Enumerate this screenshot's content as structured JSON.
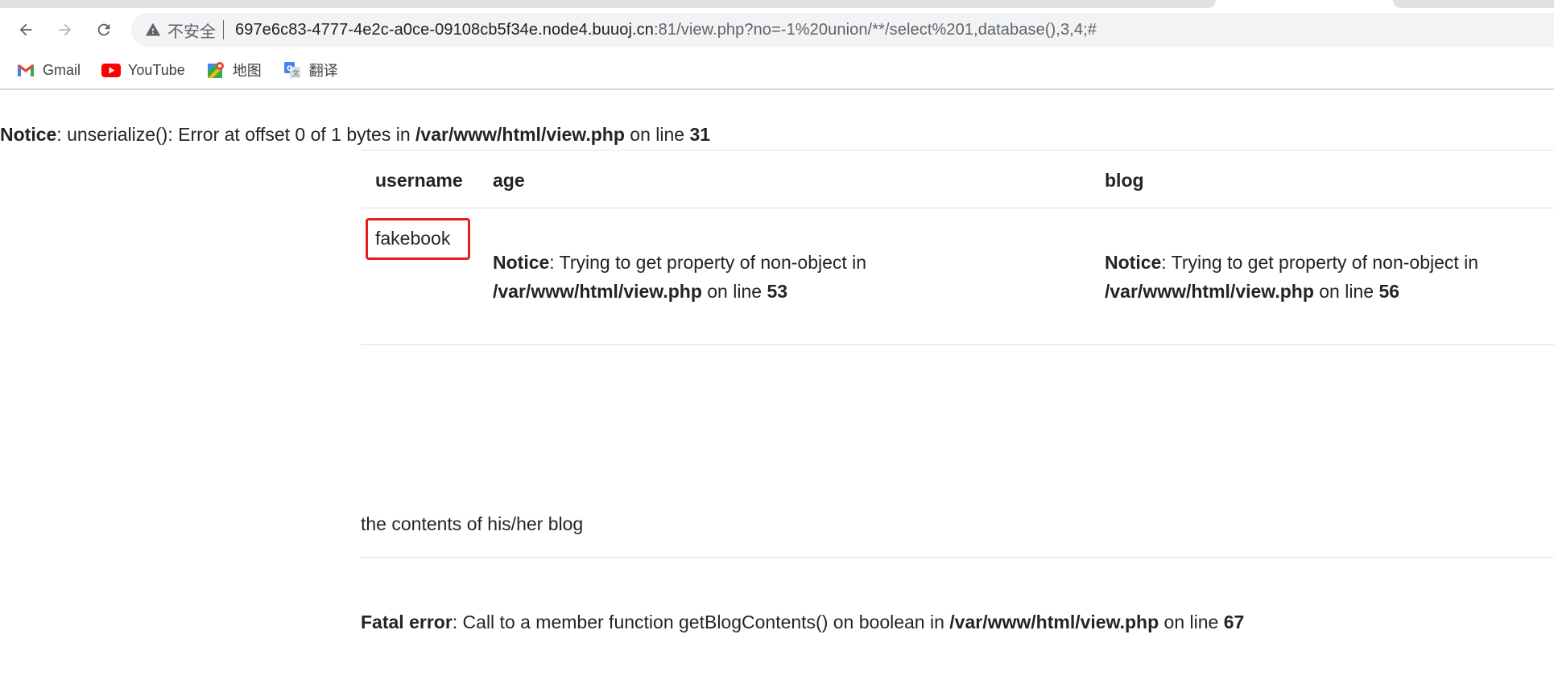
{
  "browser": {
    "address_bar": {
      "security_label": "不安全",
      "url_host": "697e6c83-4777-4e2c-a0ce-09108cb5f34e.node4.buuoj.cn",
      "url_rest": ":81/view.php?no=-1%20union/**/select%201,database(),3,4;#"
    },
    "bookmarks": [
      {
        "label": "Gmail",
        "icon": "gmail-icon"
      },
      {
        "label": "YouTube",
        "icon": "youtube-icon"
      },
      {
        "label": "地图",
        "icon": "maps-icon"
      },
      {
        "label": "翻译",
        "icon": "translate-icon"
      }
    ]
  },
  "page": {
    "notice_top": {
      "label": "Notice",
      "message": ": unserialize(): Error at offset 0 of 1 bytes in ",
      "path": "/var/www/html/view.php",
      "on_line": " on line ",
      "line": "31"
    },
    "table": {
      "headers": [
        "username",
        "age",
        "blog"
      ],
      "row": {
        "username": "fakebook",
        "age_notice": {
          "label": "Notice",
          "message": ": Trying to get property of non-object in",
          "path": "/var/www/html/view.php",
          "on_line": " on line ",
          "line": "53"
        },
        "blog_notice": {
          "label": "Notice",
          "message": ": Trying to get property of non-object in",
          "path": "/var/www/html/view.php",
          "on_line": " on line ",
          "line": "56"
        }
      }
    },
    "blog_contents": "the contents of his/her blog",
    "fatal_error": {
      "label": "Fatal error",
      "message": ": Call to a member function getBlogContents() on boolean in ",
      "path": "/var/www/html/view.php",
      "on_line": " on line ",
      "line": "67"
    }
  },
  "colors": {
    "highlight_box": "#e02020",
    "gmail_red": "#ea4335",
    "youtube_red": "#ff0000",
    "icon_gray": "#5f6368"
  }
}
